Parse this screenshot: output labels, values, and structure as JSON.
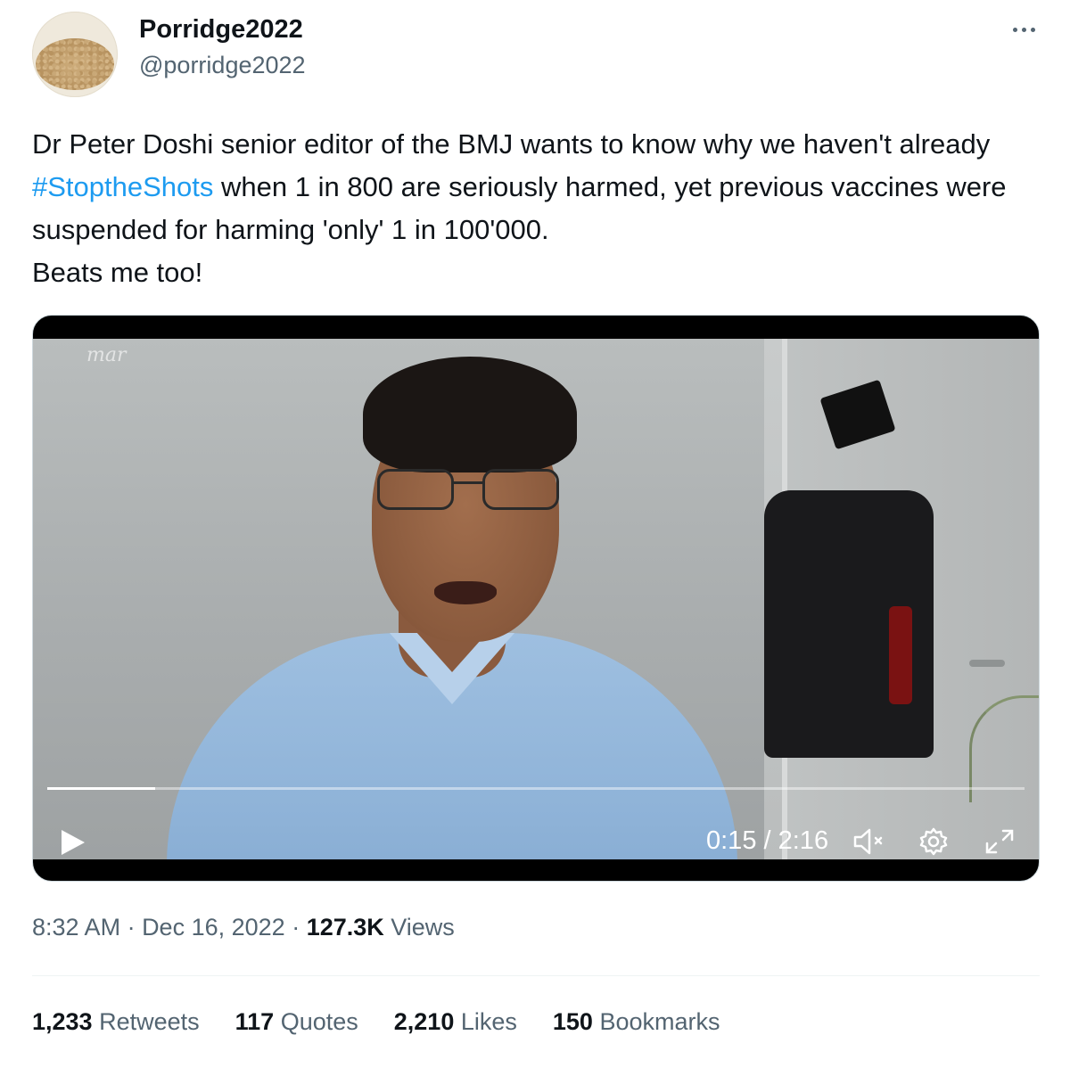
{
  "author": {
    "display_name": "Porridge2022",
    "handle": "@porridge2022",
    "avatar_icon": "porridge-bowl-avatar"
  },
  "tweet": {
    "text_1": "Dr Peter Doshi senior editor of the BMJ wants to know why we haven't already ",
    "hashtag": "#StoptheShots",
    "text_2": " when 1 in 800 are seriously harmed, yet previous vaccines were suspended for harming 'only' 1 in 100'000.",
    "text_3": "Beats me too!"
  },
  "video": {
    "watermark": "mar",
    "current_time": "0:15",
    "separator": " / ",
    "duration": "2:16",
    "progress_fraction": 0.11,
    "controls": {
      "play_icon": "play-icon",
      "mute_icon": "volume-muted-icon",
      "settings_icon": "gear-icon",
      "fullscreen_icon": "expand-icon"
    }
  },
  "meta": {
    "time": "8:32 AM",
    "dot": " · ",
    "date": "Dec 16, 2022",
    "views_count": "127.3K",
    "views_label": " Views"
  },
  "stats": {
    "retweets": {
      "count": "1,233",
      "label": " Retweets"
    },
    "quotes": {
      "count": "117",
      "label": " Quotes"
    },
    "likes": {
      "count": "2,210",
      "label": " Likes"
    },
    "bookmarks": {
      "count": "150",
      "label": " Bookmarks"
    }
  },
  "colors": {
    "text": "#0f1419",
    "secondary": "#536471",
    "link": "#1d9bf0"
  }
}
